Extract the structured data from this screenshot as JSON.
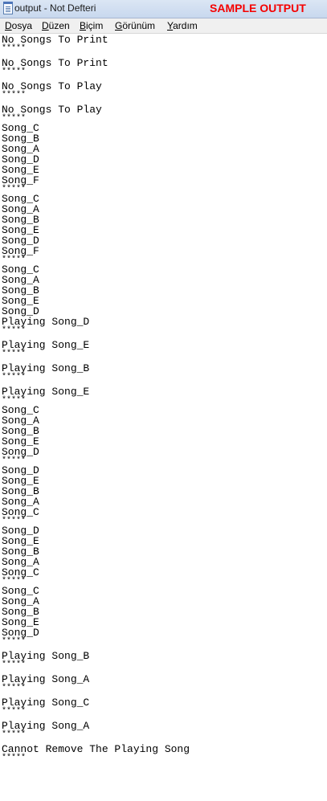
{
  "window": {
    "title": "output - Not Defteri",
    "badge": "SAMPLE OUTPUT",
    "badge_color": "#f50000",
    "icon": "notepad-icon"
  },
  "menu": [
    {
      "accel": "D",
      "rest": "osya"
    },
    {
      "accel": "D",
      "rest": "üzen"
    },
    {
      "accel": "B",
      "rest": "içim"
    },
    {
      "accel": "G",
      "rest": "örünüm"
    },
    {
      "accel": "Y",
      "rest": "ardım"
    }
  ],
  "document": {
    "lines": [
      "No Songs To Print",
      "*****",
      "No Songs To Print",
      "*****",
      "No Songs To Play",
      "*****",
      "No Songs To Play",
      "*****",
      "Song_C",
      "Song_B",
      "Song_A",
      "Song_D",
      "Song_E",
      "Song_F",
      "*****",
      "Song_C",
      "Song_A",
      "Song_B",
      "Song_E",
      "Song_D",
      "Song_F",
      "*****",
      "Song_C",
      "Song_A",
      "Song_B",
      "Song_E",
      "Song_D",
      "Playing Song_D",
      "*****",
      "Playing Song_E",
      "*****",
      "Playing Song_B",
      "*****",
      "Playing Song_E",
      "*****",
      "Song_C",
      "Song_A",
      "Song_B",
      "Song_E",
      "Song_D",
      "*****",
      "Song_D",
      "Song_E",
      "Song_B",
      "Song_A",
      "Song_C",
      "*****",
      "Song_D",
      "Song_E",
      "Song_B",
      "Song_A",
      "Song_C",
      "*****",
      "Song_C",
      "Song_A",
      "Song_B",
      "Song_E",
      "Song_D",
      "*****",
      "Playing Song_B",
      "*****",
      "Playing Song_A",
      "*****",
      "Playing Song_C",
      "*****",
      "Playing Song_A",
      "*****",
      "Cannot Remove The Playing Song",
      "*****"
    ]
  }
}
